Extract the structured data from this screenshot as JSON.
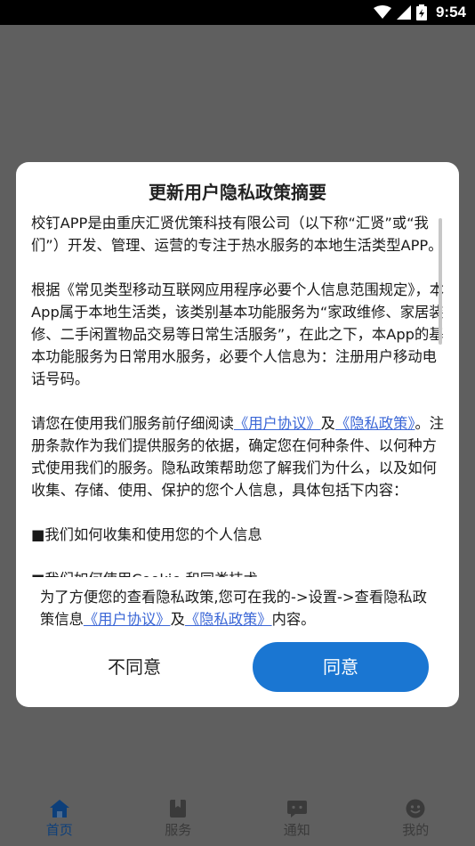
{
  "status_bar": {
    "time": "9:54",
    "icons": [
      "wifi-icon",
      "cell-signal-icon",
      "battery-icon"
    ]
  },
  "tabbar": {
    "items": [
      {
        "label": "首页",
        "icon": "home-icon",
        "active": true
      },
      {
        "label": "服务",
        "icon": "bookmark-icon",
        "active": false
      },
      {
        "label": "通知",
        "icon": "message-icon",
        "active": false
      },
      {
        "label": "我的",
        "icon": "smiley-icon",
        "active": false
      }
    ]
  },
  "dialog": {
    "title": "更新用户隐私政策摘要",
    "paragraph1": "校钉APP是由重庆汇贤优策科技有限公司（以下称“汇贤”或“我们”）开发、管理、运营的专注于热水服务的本地生活类型APP。",
    "paragraph2": "根据《常见类型移动互联网应用程序必要个人信息范围规定》，本App属于本地生活类，该类别基本功能服务为“家政维修、家居装修、二手闲置物品交易等日常生活服务”，在此之下，本App的基本功能服务为日常用水服务，必要个人信息为：注册用户移动电话号码。",
    "paragraph3": {
      "part1": "请您在使用我们服务前仔细阅读",
      "link1": "《用户协议》",
      "part2": "及",
      "link2": "《隐私政策》",
      "part3": "。注册条款作为我们提供服务的依据，确定您在何种条件、以何种方式使用我们的服务。隐私政策帮助您了解我们为什么，以及如何收集、存储、使用、保护的您个人信息，具体包括下内容："
    },
    "bullet1": "■我们如何收集和使用您的个人信息",
    "bullet2": "■我们如何使用Cookie 和同类技术",
    "footer": {
      "part1": "为了方便您的查看隐私政策,您可在我的->设置->查看隐私政策信息",
      "link1": "《用户协议》",
      "part2": "及",
      "link2": "《隐私政策》",
      "part3": "内容。"
    },
    "disagree_label": "不同意",
    "agree_label": "同意",
    "accent_color": "#1a76d2",
    "link_color": "#3a66d6"
  }
}
